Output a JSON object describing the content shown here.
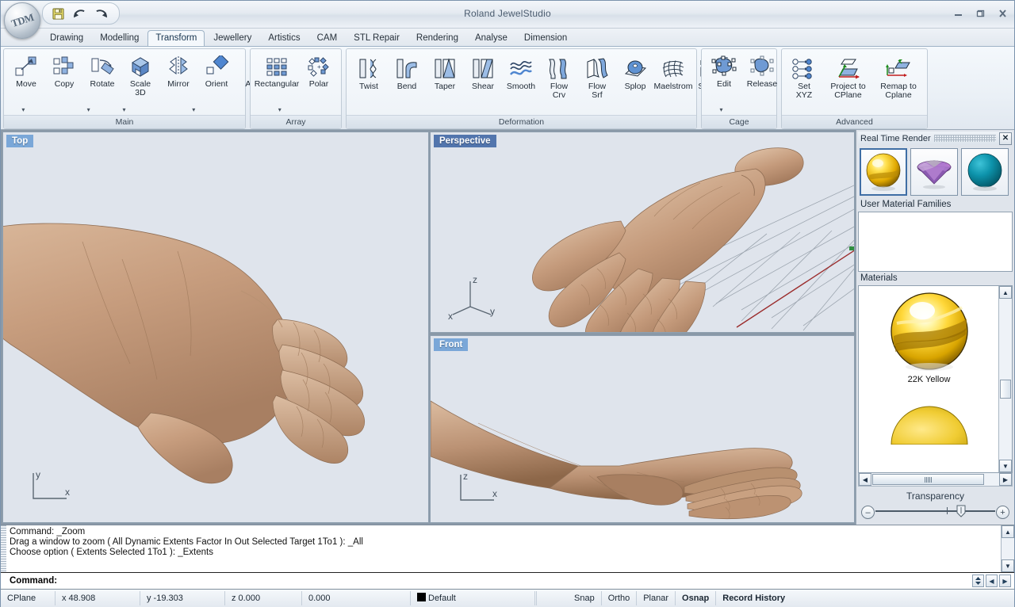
{
  "window": {
    "title": "Roland JewelStudio",
    "orb_label": "TDM",
    "minimize": "–",
    "maximize": "❐",
    "close": "✕"
  },
  "quick_access": [
    {
      "name": "save-icon",
      "tip": "Save"
    },
    {
      "name": "undo-icon",
      "tip": "Undo"
    },
    {
      "name": "redo-icon",
      "tip": "Redo"
    }
  ],
  "tabs": [
    {
      "label": "Drawing",
      "active": false
    },
    {
      "label": "Modelling",
      "active": false
    },
    {
      "label": "Transform",
      "active": true
    },
    {
      "label": "Jewellery",
      "active": false
    },
    {
      "label": "Artistics",
      "active": false
    },
    {
      "label": "CAM",
      "active": false
    },
    {
      "label": "STL Repair",
      "active": false
    },
    {
      "label": "Rendering",
      "active": false
    },
    {
      "label": "Analyse",
      "active": false
    },
    {
      "label": "Dimension",
      "active": false
    }
  ],
  "ribbon": {
    "groups": [
      {
        "title": "Main",
        "items": [
          {
            "label": "Move",
            "icon": "move-icon",
            "caret": true
          },
          {
            "label": "Copy",
            "icon": "copy-icon",
            "caret": false
          },
          {
            "label": "Rotate",
            "icon": "rotate-icon",
            "caret": true
          },
          {
            "label": "Scale 3D",
            "icon": "scale3d-icon",
            "caret": true
          },
          {
            "label": "Mirror",
            "icon": "mirror-icon",
            "caret": false
          },
          {
            "label": "Orient",
            "icon": "orient-icon",
            "caret": true
          },
          {
            "label": "Align",
            "icon": "align-icon",
            "caret": false
          }
        ]
      },
      {
        "title": "Array",
        "items": [
          {
            "label": "Rectangular",
            "icon": "rectangular-array-icon",
            "caret": true
          },
          {
            "label": "Polar",
            "icon": "polar-array-icon",
            "caret": false
          }
        ]
      },
      {
        "title": "Deformation",
        "items": [
          {
            "label": "Twist",
            "icon": "twist-icon",
            "caret": false
          },
          {
            "label": "Bend",
            "icon": "bend-icon",
            "caret": false
          },
          {
            "label": "Taper",
            "icon": "taper-icon",
            "caret": false
          },
          {
            "label": "Shear",
            "icon": "shear-icon",
            "caret": false
          },
          {
            "label": "Smooth",
            "icon": "smooth-icon",
            "caret": false
          },
          {
            "label": "Flow\nCrv",
            "icon": "flow-curve-icon",
            "caret": false
          },
          {
            "label": "Flow\nSrf",
            "icon": "flow-surface-icon",
            "caret": false
          },
          {
            "label": "Splop",
            "icon": "splop-icon",
            "caret": false
          },
          {
            "label": "Maelstrom",
            "icon": "maelstrom-icon",
            "caret": false
          },
          {
            "label": "Stretch",
            "icon": "stretch-icon",
            "caret": false
          }
        ]
      },
      {
        "title": "Cage",
        "items": [
          {
            "label": "Edit",
            "icon": "cage-edit-icon",
            "caret": true
          },
          {
            "label": "Release",
            "icon": "cage-release-icon",
            "caret": false
          }
        ]
      },
      {
        "title": "Advanced",
        "items": [
          {
            "label": "Set\nXYZ",
            "icon": "set-xyz-icon",
            "caret": false
          },
          {
            "label": "Project to\nCPlane",
            "icon": "project-to-cplane-icon",
            "caret": false
          },
          {
            "label": "Remap to\nCplane",
            "icon": "remap-to-cplane-icon",
            "caret": false
          }
        ]
      }
    ]
  },
  "viewports": [
    {
      "label": "Top",
      "active": false,
      "axes": "y-x"
    },
    {
      "label": "Perspective",
      "active": true,
      "axes": "z-x-y"
    },
    {
      "label": "Front",
      "active": false,
      "axes": "z-x"
    }
  ],
  "right_panel": {
    "title": "Real Time Render",
    "close_label": "✕",
    "material_buttons": [
      {
        "name": "gold-sphere-preview",
        "selected": true
      },
      {
        "name": "gemstone-preview",
        "selected": false
      },
      {
        "name": "teal-sphere-preview",
        "selected": false
      }
    ],
    "user_material_families_label": "User Material Families",
    "materials_label": "Materials",
    "materials": [
      {
        "name": "22K Yellow"
      }
    ],
    "transparency_label": "Transparency",
    "transparency_minus": "–",
    "transparency_plus": "+"
  },
  "command": {
    "history": [
      "Command: _Zoom",
      "Drag a window to zoom ( All  Dynamic  Extents  Factor  In  Out  Selected  Target  1To1 ): _All",
      "Choose option ( Extents  Selected  1To1 ): _Extents"
    ],
    "prompt_label": "Command:",
    "prompt_value": ""
  },
  "status": {
    "cplane": "CPlane",
    "x": "x 48.908",
    "y": "y -19.303",
    "z": "z 0.000",
    "extra": "0.000",
    "layer": "Default",
    "toggles": [
      {
        "label": "Snap",
        "bold": false
      },
      {
        "label": "Ortho",
        "bold": false
      },
      {
        "label": "Planar",
        "bold": false
      },
      {
        "label": "Osnap",
        "bold": true
      },
      {
        "label": "Record History",
        "bold": true
      }
    ]
  },
  "colors": {
    "accent_tab": "#5275ad",
    "viewport_label_inactive": "#7aa7d8",
    "viewport_bg": "#dfe4ec",
    "skin": "#c69b7b",
    "gold": "#f5c518"
  }
}
